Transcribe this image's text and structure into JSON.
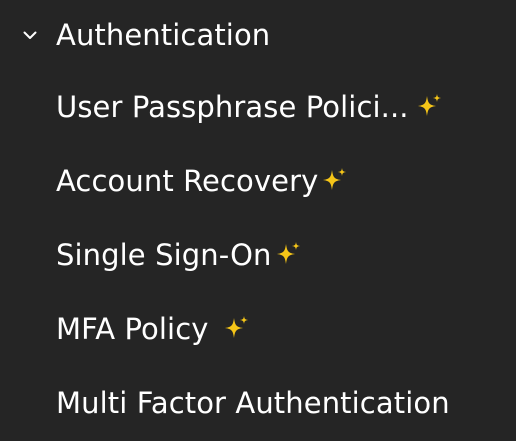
{
  "nav": {
    "group_title": "Authentication",
    "group_icon": "chevron-down-icon",
    "items": [
      {
        "label": "User Passphrase Polici...",
        "badge": "sparkle-icon"
      },
      {
        "label": "Account Recovery",
        "badge": "sparkle-icon"
      },
      {
        "label": "Single Sign-On",
        "badge": "sparkle-icon"
      },
      {
        "label": "MFA Policy",
        "badge": "sparkle-icon"
      },
      {
        "label": "Multi Factor Authentication",
        "badge": null
      }
    ]
  },
  "colors": {
    "background": "#252525",
    "text": "#ffffff",
    "sparkle": "#f5c518"
  }
}
